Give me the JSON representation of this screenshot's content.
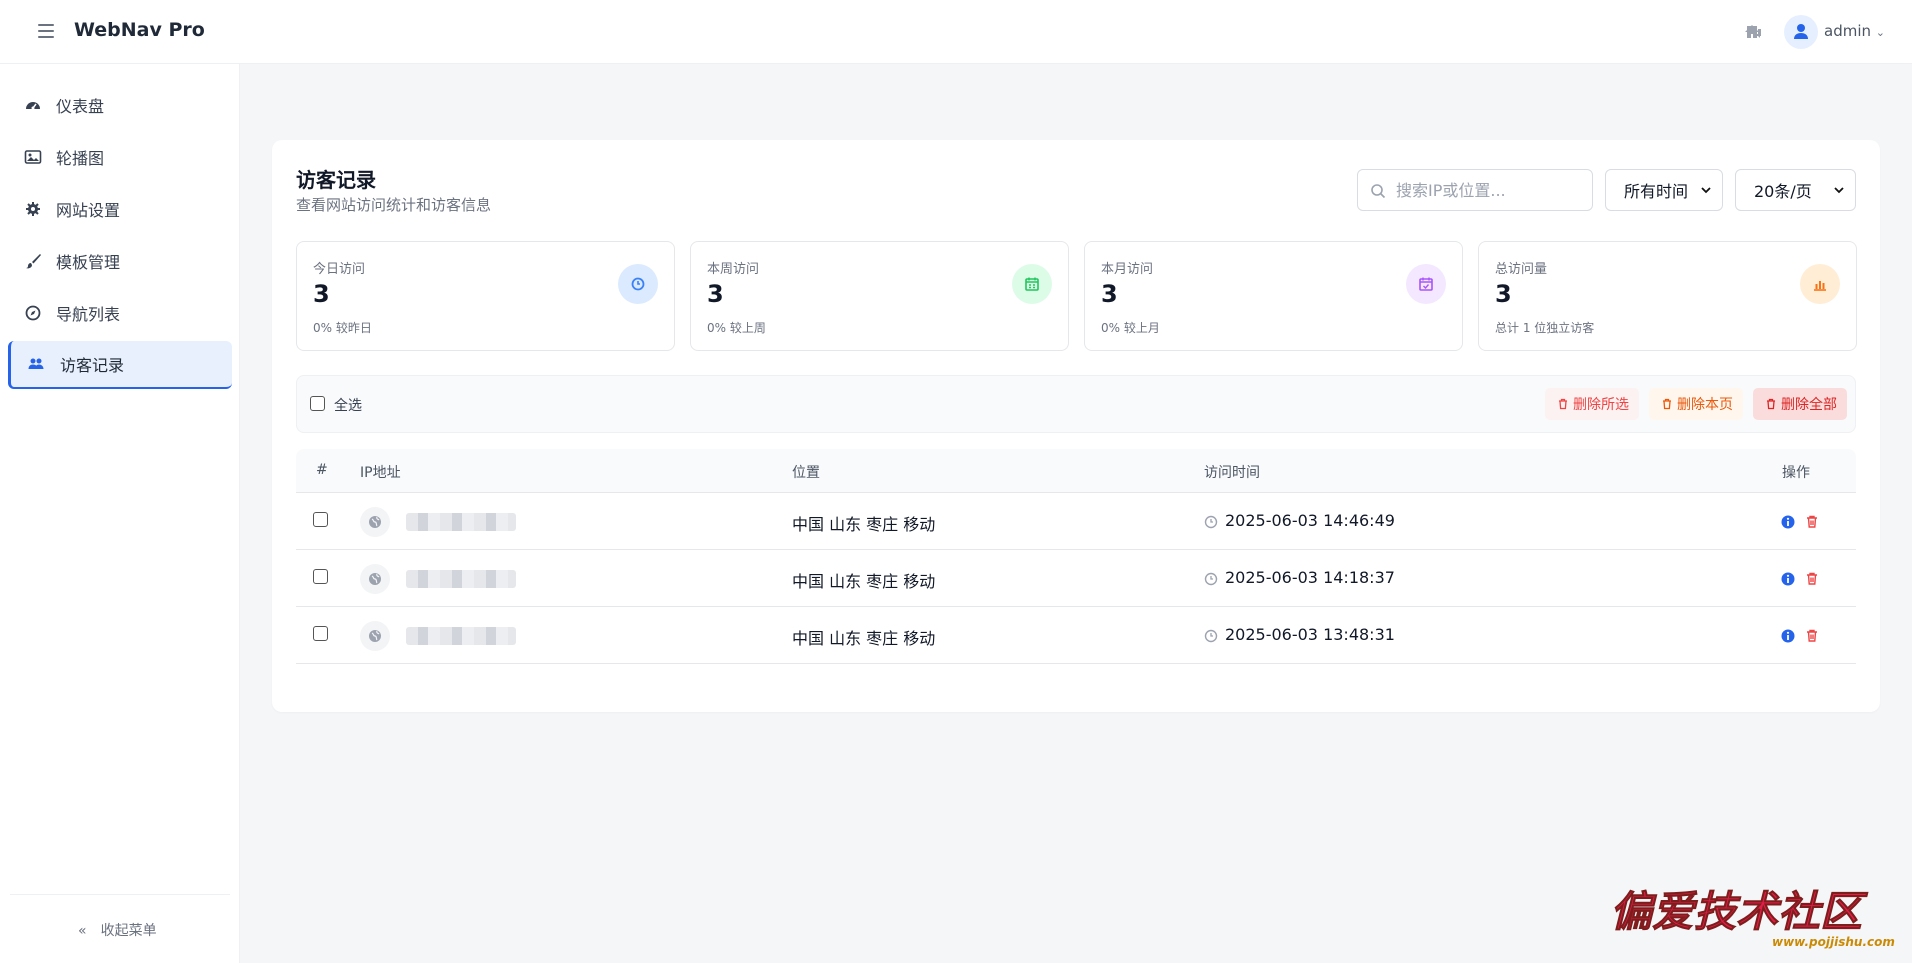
{
  "app": {
    "title": "WebNav Pro",
    "user": "admin"
  },
  "sidebar": {
    "items": [
      {
        "label": "仪表盘",
        "icon": "dashboard-icon"
      },
      {
        "label": "轮播图",
        "icon": "image-icon"
      },
      {
        "label": "网站设置",
        "icon": "gear-icon"
      },
      {
        "label": "模板管理",
        "icon": "brush-icon"
      },
      {
        "label": "导航列表",
        "icon": "compass-icon"
      },
      {
        "label": "访客记录",
        "icon": "users-icon",
        "active": true
      }
    ],
    "collapse_label": "收起菜单"
  },
  "page": {
    "title": "访客记录",
    "subtitle": "查看网站访问统计和访客信息",
    "search_placeholder": "搜索IP或位置...",
    "time_filter": "所有时间",
    "page_size": "20条/页"
  },
  "stats": [
    {
      "label": "今日访问",
      "value": "3",
      "note": "0% 较昨日",
      "color": "#3b82f6",
      "bg": "#dbeafe"
    },
    {
      "label": "本周访问",
      "value": "3",
      "note": "0% 较上周",
      "color": "#22c55e",
      "bg": "#dcfce7"
    },
    {
      "label": "本月访问",
      "value": "3",
      "note": "0% 较上月",
      "color": "#a855f7",
      "bg": "#f3e8ff"
    },
    {
      "label": "总访问量",
      "value": "3",
      "note": "总计 1 位独立访客",
      "color": "#f97316",
      "bg": "#ffedd5"
    }
  ],
  "bulk": {
    "select_all": "全选",
    "delete_selected": "删除所选",
    "delete_page": "删除本页",
    "delete_all": "删除全部"
  },
  "table": {
    "headers": [
      "#",
      "IP地址",
      "位置",
      "访问时间",
      "操作"
    ],
    "rows": [
      {
        "location": "中国 山东 枣庄 移动",
        "time": "2025-06-03 14:46:49"
      },
      {
        "location": "中国 山东 枣庄 移动",
        "time": "2025-06-03 14:18:37"
      },
      {
        "location": "中国 山东 枣庄 移动",
        "time": "2025-06-03 13:48:31"
      }
    ]
  },
  "colors": {
    "accent": "#2563eb",
    "danger": "#ef4444",
    "warning": "#ea580c"
  },
  "watermark": {
    "text": "偏爱技术社区",
    "url": "www.pojjishu.com"
  }
}
